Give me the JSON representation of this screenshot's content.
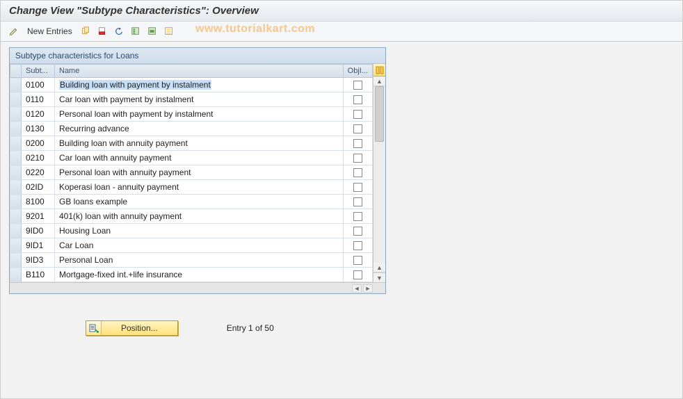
{
  "header": {
    "title": "Change View \"Subtype Characteristics\": Overview"
  },
  "toolbar": {
    "new_entries_label": "New Entries",
    "watermark": "www.tutorialkart.com"
  },
  "tableview": {
    "title": "Subtype characteristics for Loans",
    "columns": {
      "subt": "Subt...",
      "name": "Name",
      "obj": "ObjI..."
    },
    "rows": [
      {
        "subt": "0100",
        "name": "Building loan with payment by instalment",
        "obj": false,
        "selected": true
      },
      {
        "subt": "0110",
        "name": "Car loan with payment by instalment",
        "obj": false
      },
      {
        "subt": "0120",
        "name": "Personal loan with payment by instalment",
        "obj": false
      },
      {
        "subt": "0130",
        "name": "Recurring advance",
        "obj": false
      },
      {
        "subt": "0200",
        "name": "Building loan with annuity payment",
        "obj": false
      },
      {
        "subt": "0210",
        "name": "Car loan with annuity payment",
        "obj": false
      },
      {
        "subt": "0220",
        "name": "Personal loan with annuity payment",
        "obj": false
      },
      {
        "subt": "02ID",
        "name": "Koperasi loan - annuity payment",
        "obj": false
      },
      {
        "subt": "8100",
        "name": "GB loans example",
        "obj": false
      },
      {
        "subt": "9201",
        "name": "401(k) loan with annuity payment",
        "obj": false
      },
      {
        "subt": "9ID0",
        "name": "Housing Loan",
        "obj": false
      },
      {
        "subt": "9ID1",
        "name": "Car Loan",
        "obj": false
      },
      {
        "subt": "9ID3",
        "name": "Personal Loan",
        "obj": false
      },
      {
        "subt": "B110",
        "name": "Mortgage-fixed int.+life insurance",
        "obj": false
      }
    ]
  },
  "footer": {
    "position_label": "Position...",
    "entry_status": "Entry 1 of 50"
  }
}
